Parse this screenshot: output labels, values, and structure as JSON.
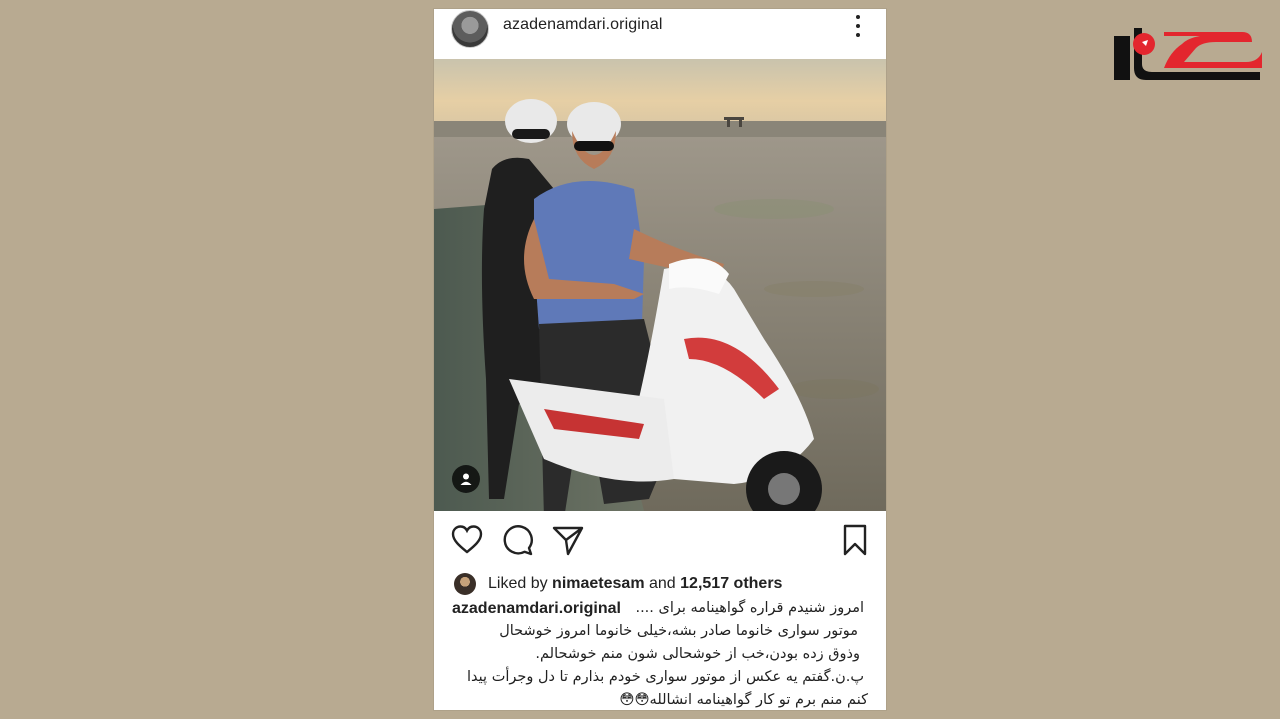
{
  "post": {
    "username": "azadenamdari.original",
    "liked_by_prefix": "Liked by",
    "liked_by_user": "nimaetesam",
    "liked_by_and": "and",
    "likes_others": "12,517 others",
    "caption_user": "azadenamdari.original",
    "caption_lines": [
      "امروز شنیدم قراره گواهینامه برای ....",
      "موتور سواری خانوما صادر بشه،خیلی خانوما امروز خوشحال",
      "وذوق زده بودن،خب از خوشحالی شون منم خوشحالم.",
      "پ.ن.گفتم یه عکس از موتور سواری خودم بذارم تا دل وجرأت پیدا",
      "کنم منم برم تو کار گواهینامه انشالله😳😳"
    ]
  },
  "icons": {
    "more": "more-vertical-icon",
    "like": "heart-icon",
    "comment": "comment-icon",
    "share": "share-icon",
    "save": "bookmark-icon",
    "tag": "user-tag-icon"
  },
  "colors": {
    "background": "#b8aa91",
    "card": "#ffffff",
    "logo_red": "#e3262e",
    "logo_black": "#111111"
  }
}
